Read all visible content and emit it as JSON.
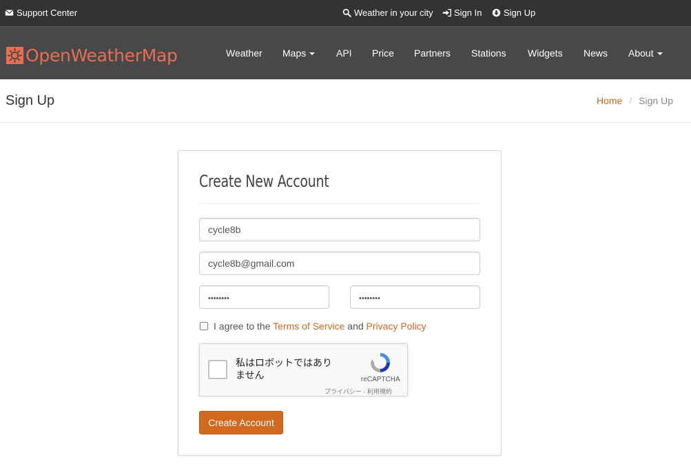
{
  "topbar": {
    "support_label": "Support Center",
    "weather_label": "Weather in your city",
    "signin_label": "Sign In",
    "signup_label": "Sign Up"
  },
  "brand": {
    "name": "OpenWeatherMap",
    "color": "#e96e50"
  },
  "nav": {
    "items": [
      {
        "label": "Weather",
        "dropdown": false
      },
      {
        "label": "Maps",
        "dropdown": true
      },
      {
        "label": "API",
        "dropdown": false
      },
      {
        "label": "Price",
        "dropdown": false
      },
      {
        "label": "Partners",
        "dropdown": false
      },
      {
        "label": "Stations",
        "dropdown": false
      },
      {
        "label": "Widgets",
        "dropdown": false
      },
      {
        "label": "News",
        "dropdown": false
      },
      {
        "label": "About",
        "dropdown": true
      }
    ]
  },
  "page_header": {
    "title": "Sign Up",
    "breadcrumb": {
      "home": "Home",
      "separator": "/",
      "current": "Sign Up"
    }
  },
  "form": {
    "title": "Create New Account",
    "username_value": "cycle8b",
    "email_value": "cycle8b@gmail.com",
    "password_value": "••••••••",
    "password_confirm_value": "••••••••",
    "agree_text": "I agree to the",
    "terms_link": "Terms of Service",
    "and_text": "and",
    "privacy_link": "Privacy Policy",
    "recaptcha": {
      "label": "私はロボットではありません",
      "brand": "reCAPTCHA",
      "terms": "プライバシー - 利用規約"
    },
    "submit_label": "Create Account",
    "accent_color": "#d2691e"
  }
}
